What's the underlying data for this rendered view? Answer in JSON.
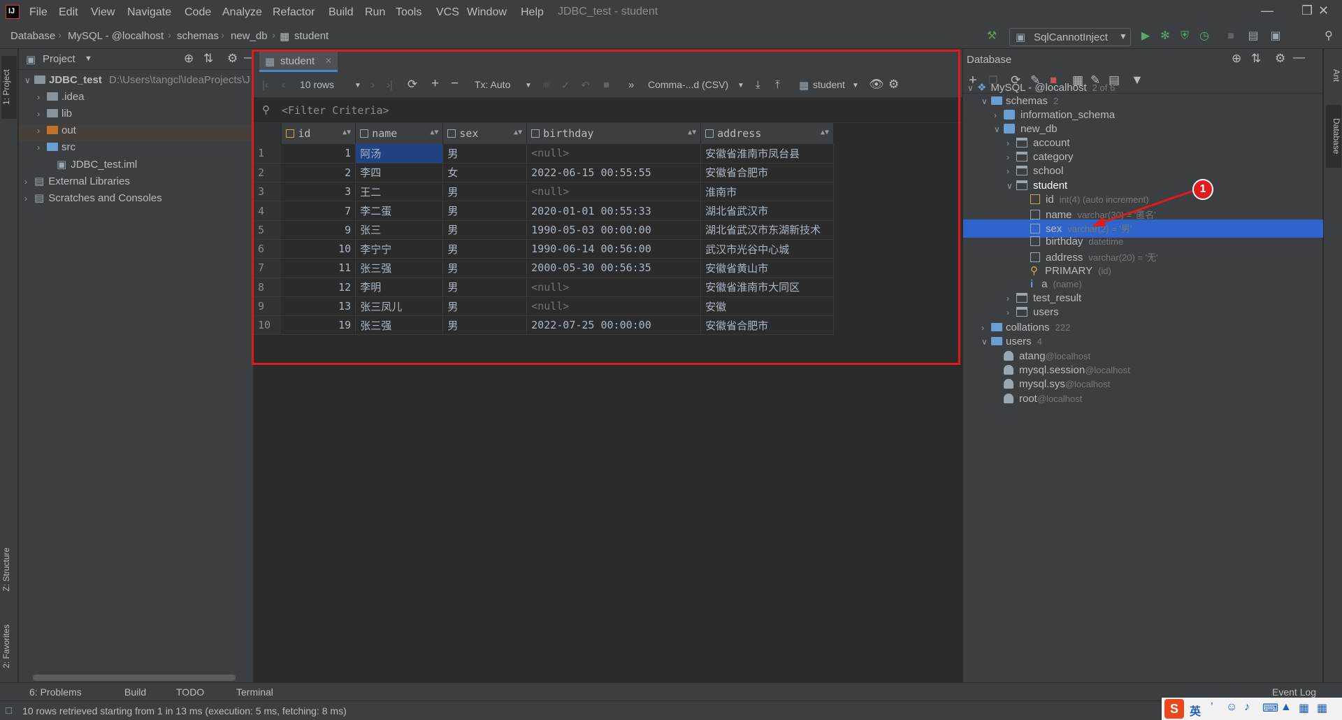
{
  "menubar": {
    "logo_text": "IJ",
    "items": [
      "File",
      "Edit",
      "View",
      "Navigate",
      "Code",
      "Analyze",
      "Refactor",
      "Build",
      "Run",
      "Tools",
      "VCS",
      "Window",
      "Help"
    ],
    "window_title": "JDBC_test - student"
  },
  "navbar": {
    "breadcrumbs": [
      "Database",
      "MySQL - @localhost",
      "schemas",
      "new_db",
      "student"
    ],
    "run_config": "SqlCannotInject"
  },
  "left_strip": {
    "tabs": [
      "1: Project",
      "Z: Structure",
      "2: Favorites"
    ]
  },
  "project": {
    "title": "Project",
    "root_name": "JDBC_test",
    "root_path": "D:\\Users\\tangcl\\IdeaProjects\\J",
    "items": [
      ".idea",
      "lib",
      "out",
      "src",
      "JDBC_test.iml",
      "External Libraries",
      "Scratches and Consoles"
    ]
  },
  "editor": {
    "tab_label": "student",
    "toolbar": {
      "rows": "10 rows",
      "tx": "Tx: Auto",
      "export_format": "Comma-...d (CSV)",
      "table": "student"
    },
    "filter_placeholder": "<Filter Criteria>",
    "columns": [
      "id",
      "name",
      "sex",
      "birthday",
      "address"
    ],
    "rows": [
      {
        "n": "1",
        "id": "1",
        "name": "阿汤",
        "sex": "男",
        "birthday": "<null>",
        "address": "安徽省淮南市凤台县"
      },
      {
        "n": "2",
        "id": "2",
        "name": "李四",
        "sex": "女",
        "birthday": "2022-06-15 00:55:55",
        "address": "安徽省合肥市"
      },
      {
        "n": "3",
        "id": "3",
        "name": "王二",
        "sex": "男",
        "birthday": "<null>",
        "address": "淮南市"
      },
      {
        "n": "4",
        "id": "7",
        "name": "李二蛋",
        "sex": "男",
        "birthday": "2020-01-01 00:55:33",
        "address": "湖北省武汉市"
      },
      {
        "n": "5",
        "id": "9",
        "name": "张三",
        "sex": "男",
        "birthday": "1990-05-03 00:00:00",
        "address": "湖北省武汉市东湖新技术"
      },
      {
        "n": "6",
        "id": "10",
        "name": "李宁宁",
        "sex": "男",
        "birthday": "1990-06-14 00:56:00",
        "address": "武汉市光谷中心城"
      },
      {
        "n": "7",
        "id": "11",
        "name": "张三强",
        "sex": "男",
        "birthday": "2000-05-30 00:56:35",
        "address": "安徽省黄山市"
      },
      {
        "n": "8",
        "id": "12",
        "name": "李明",
        "sex": "男",
        "birthday": "<null>",
        "address": "安徽省淮南市大同区"
      },
      {
        "n": "9",
        "id": "13",
        "name": "张三凤儿",
        "sex": "男",
        "birthday": "<null>",
        "address": "安徽"
      },
      {
        "n": "10",
        "id": "19",
        "name": "张三强",
        "sex": "男",
        "birthday": "2022-07-25 00:00:00",
        "address": "安徽省合肥市"
      }
    ]
  },
  "database": {
    "title": "Database",
    "datasource": "MySQL - @localhost",
    "datasource_meta": "2 of 6",
    "schemas_label": "schemas",
    "schemas_count": "2",
    "schema_info": "information_schema",
    "schema_new": "new_db",
    "tables": [
      "account",
      "category",
      "school",
      "student",
      "test_result",
      "users"
    ],
    "student_columns": [
      {
        "name": "id",
        "meta": "int(4) (auto increment)"
      },
      {
        "name": "name",
        "meta": "varchar(30) = '匿名'"
      },
      {
        "name": "sex",
        "meta": "varchar(2) = '男'"
      },
      {
        "name": "birthday",
        "meta": "datetime"
      },
      {
        "name": "address",
        "meta": "varchar(20) = '无'"
      }
    ],
    "key": {
      "name": "PRIMARY",
      "meta": "(id)"
    },
    "index": {
      "name": "a",
      "meta": "(name)"
    },
    "collations_label": "collations",
    "collations_count": "222",
    "users_label": "users",
    "users_count": "4",
    "users": [
      {
        "name": "atang",
        "host": "@localhost"
      },
      {
        "name": "mysql.session",
        "host": "@localhost"
      },
      {
        "name": "mysql.sys",
        "host": "@localhost"
      },
      {
        "name": "root",
        "host": "@localhost"
      }
    ]
  },
  "right_strip": {
    "tabs": [
      "Ant",
      "Database"
    ]
  },
  "annotation": {
    "badge": "1"
  },
  "bottom": {
    "tabs": [
      "6: Problems",
      "Build",
      "TODO",
      "Terminal"
    ],
    "event_log": "Event Log",
    "status": "10 rows retrieved starting from 1 in 13 ms (execution: 5 ms, fetching: 8 ms)"
  },
  "ime": {
    "logo": "S",
    "mode": "英"
  },
  "colors": {
    "accent": "#2f65ca",
    "highlight": "#e01b1b",
    "selected_cell": "#214283"
  }
}
